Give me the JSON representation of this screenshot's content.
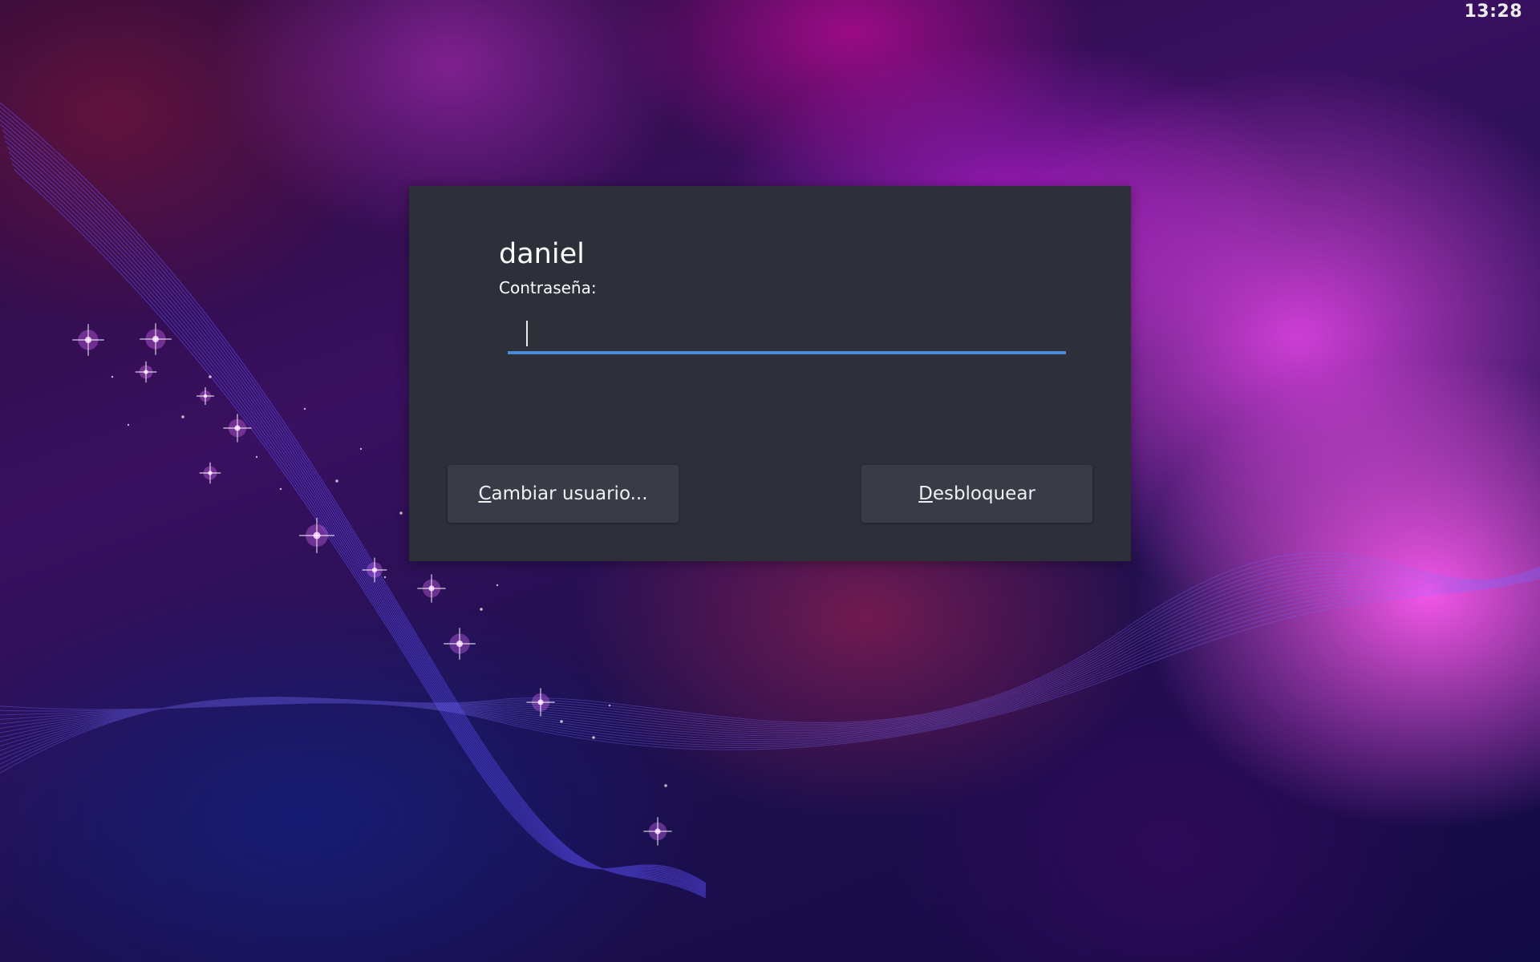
{
  "clock": {
    "time": "13:28"
  },
  "unlock_dialog": {
    "username": "daniel",
    "password_label": "Contraseña:",
    "password_value": "",
    "switch_user_button": {
      "mnemonic": "C",
      "rest": "ambiar usuario..."
    },
    "unlock_button": {
      "mnemonic": "D",
      "rest": "esbloquear"
    }
  },
  "theme": {
    "dialog_background": "#2d3039",
    "button_background": "#393c46",
    "focus_accent": "#4a8ad8"
  }
}
